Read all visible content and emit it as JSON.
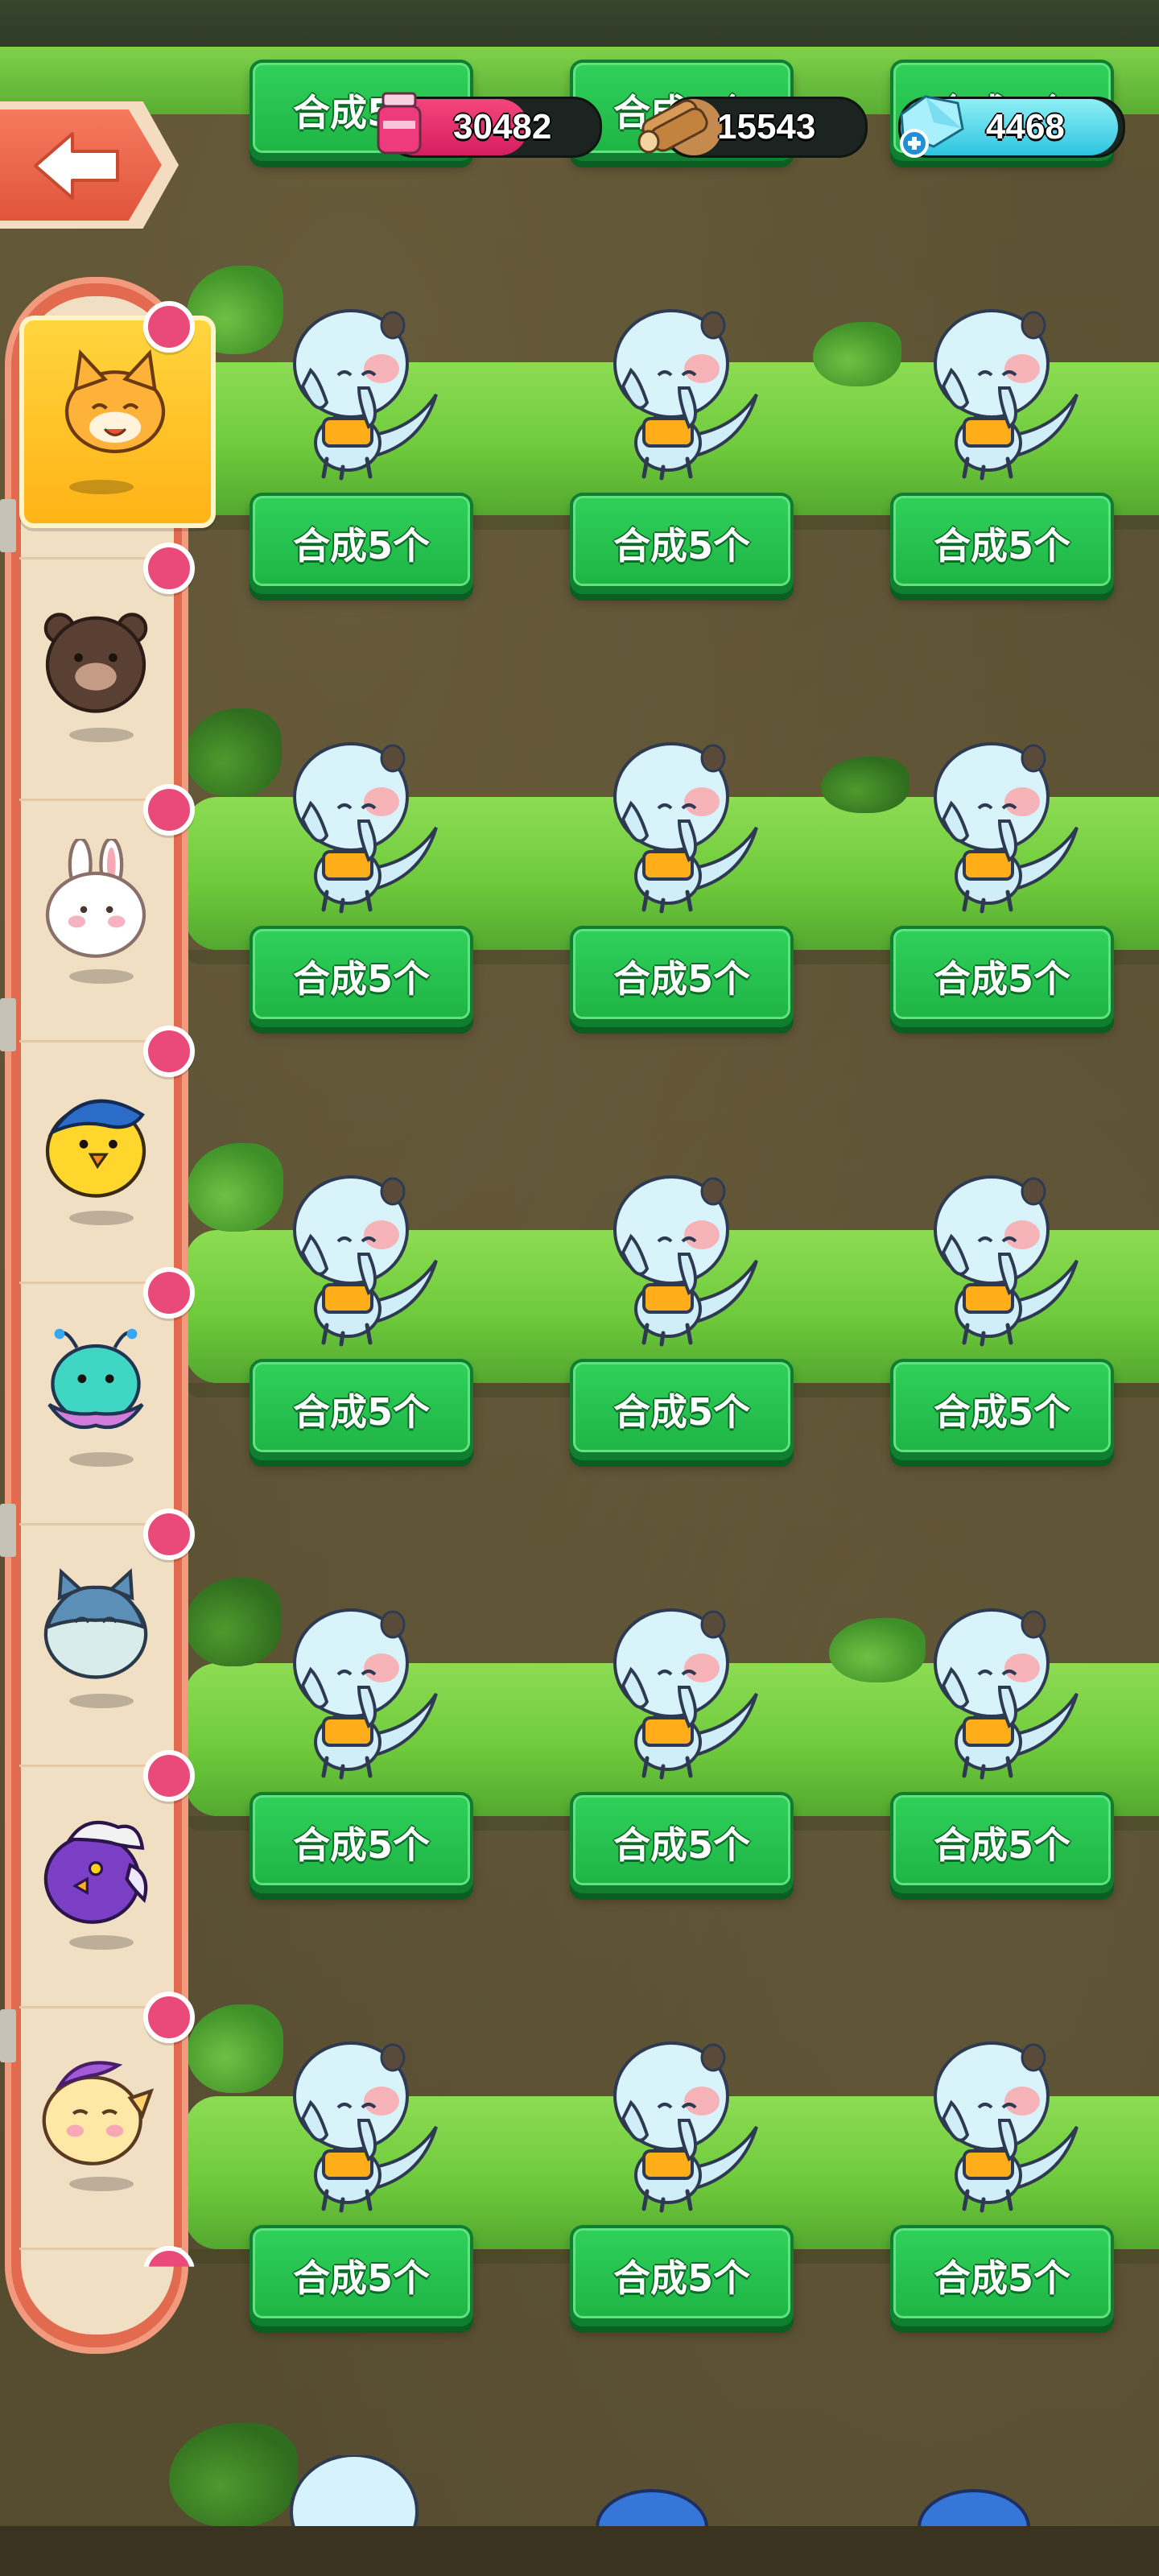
{
  "merge_label": "合成5个",
  "currency": {
    "potion": "30482",
    "wood": "15543",
    "gem": "4468"
  },
  "sidebar": {
    "items": [
      {
        "icon": "cat-icon",
        "active": true
      },
      {
        "icon": "bear-icon"
      },
      {
        "icon": "rabbit-icon"
      },
      {
        "icon": "chick-icon"
      },
      {
        "icon": "alien-icon"
      },
      {
        "icon": "shark-cat-icon"
      },
      {
        "icon": "purple-bird-icon"
      },
      {
        "icon": "pony-icon"
      }
    ]
  },
  "grid": {
    "rows": 5,
    "columns": 3,
    "creature": "otter-icon"
  },
  "colors": {
    "button_green": "#22bf4b",
    "sidebar_red": "#e26a4e",
    "notification_pink": "#e94a7a"
  }
}
